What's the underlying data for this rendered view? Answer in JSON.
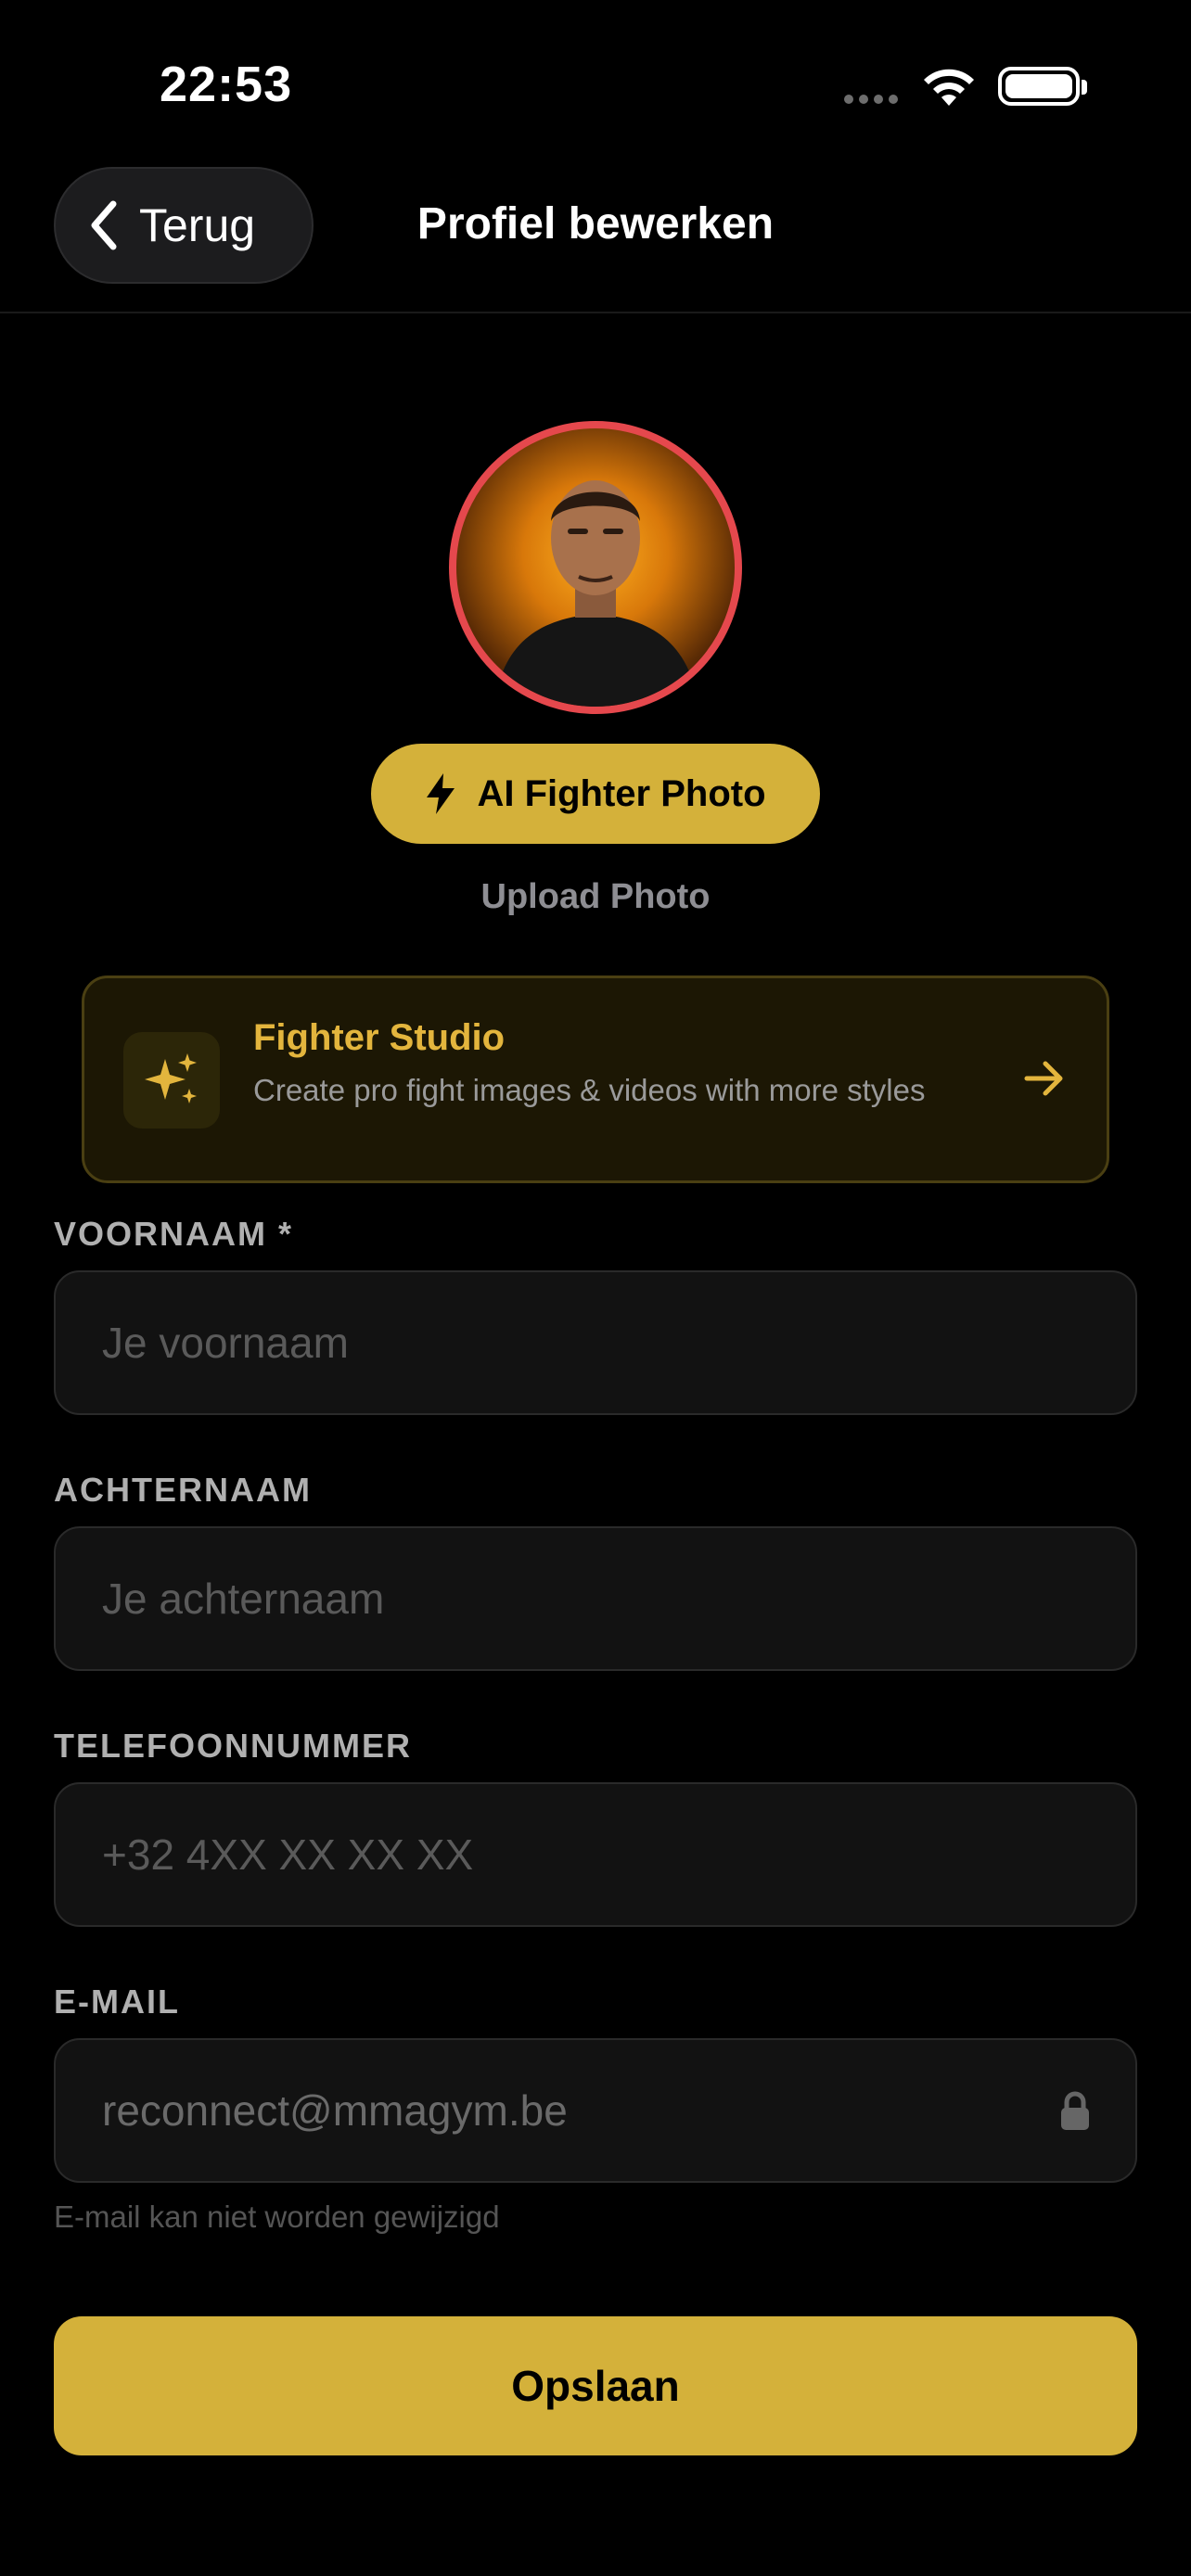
{
  "status_bar": {
    "time": "22:53"
  },
  "nav": {
    "back_label": "Terug",
    "title": "Profiel bewerken"
  },
  "profile": {
    "ai_button_label": "AI Fighter Photo",
    "upload_label": "Upload Photo"
  },
  "studio_card": {
    "title": "Fighter Studio",
    "description": "Create pro fight images & videos with more styles"
  },
  "form": {
    "first_name": {
      "label": "VOORNAAM *",
      "placeholder": "Je voornaam",
      "value": ""
    },
    "last_name": {
      "label": "ACHTERNAAM",
      "placeholder": "Je achternaam",
      "value": ""
    },
    "phone": {
      "label": "TELEFOONNUMMER",
      "placeholder": "+32 4XX XX XX XX",
      "value": ""
    },
    "email": {
      "label": "E-MAIL",
      "value": "reconnect@mmagym.be",
      "hint": "E-mail kan niet worden gewijzigd"
    }
  },
  "save_label": "Opslaan",
  "colors": {
    "accent": "#d4b13a",
    "avatar_ring": "#e5484d",
    "studio_title": "#e3b53d",
    "background": "#000000"
  },
  "icons": [
    "chevron-left-icon",
    "lightning-bolt-icon",
    "sparkles-icon",
    "arrow-right-icon",
    "lock-icon",
    "wifi-icon",
    "battery-icon",
    "signal-icon"
  ]
}
